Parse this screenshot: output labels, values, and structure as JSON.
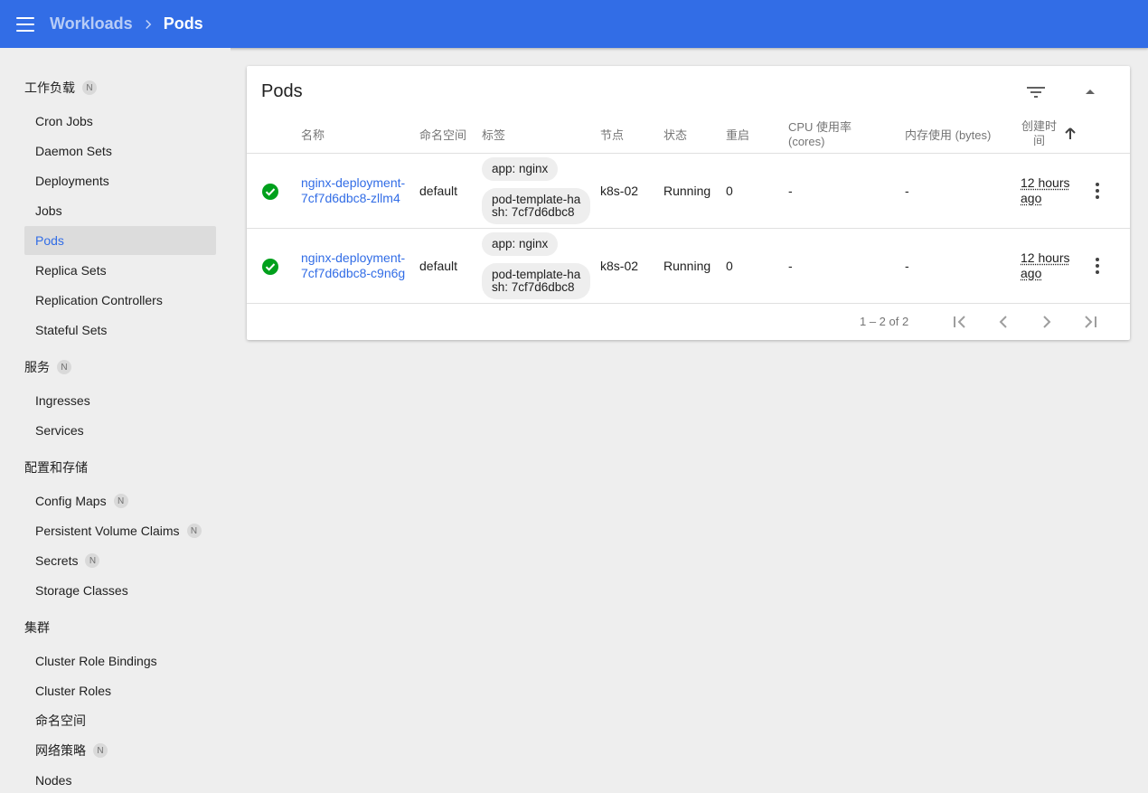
{
  "topbar": {
    "menu_icon": "menu-icon",
    "breadcrumb_parent": "Workloads",
    "breadcrumb_current": "Pods"
  },
  "sidebar": {
    "workloads_header": "工作负载",
    "workloads_items": [
      "Cron Jobs",
      "Daemon Sets",
      "Deployments",
      "Jobs",
      "Pods",
      "Replica Sets",
      "Replication Controllers",
      "Stateful Sets"
    ],
    "services_header": "服务",
    "services_items": [
      "Ingresses",
      "Services"
    ],
    "config_header": "配置和存储",
    "config_items": [
      "Config Maps",
      "Persistent Volume Claims",
      "Secrets",
      "Storage Classes"
    ],
    "cluster_header": "集群",
    "cluster_items": [
      "Cluster Role Bindings",
      "Cluster Roles",
      "命名空间",
      "网络策略",
      "Nodes"
    ],
    "namespace_badge": "N"
  },
  "card": {
    "title": "Pods",
    "columns": {
      "name": "名称",
      "namespace": "命名空间",
      "labels": "标签",
      "node": "节点",
      "status": "状态",
      "restarts": "重启",
      "cpu_line1": "CPU 使用率",
      "cpu_line2": "(cores)",
      "memory": "内存使用 (bytes)",
      "created_line1": "创建时",
      "created_line2": "间"
    },
    "rows": [
      {
        "name_line1": "nginx-deployment-",
        "name_line2": "7cf7d6dbc8-zllm4",
        "namespace": "default",
        "label1": "app: nginx",
        "label2_line1": "pod-template-ha",
        "label2_line2": "sh: 7cf7d6dbc8",
        "node": "k8s-02",
        "status": "Running",
        "restarts": "0",
        "cpu": "-",
        "memory": "-",
        "age_line1": "12 hours",
        "age_line2": "ago"
      },
      {
        "name_line1": "nginx-deployment-",
        "name_line2": "7cf7d6dbc8-c9n6g",
        "namespace": "default",
        "label1": "app: nginx",
        "label2_line1": "pod-template-ha",
        "label2_line2": "sh: 7cf7d6dbc8",
        "node": "k8s-02",
        "status": "Running",
        "restarts": "0",
        "cpu": "-",
        "memory": "-",
        "age_line1": "12 hours",
        "age_line2": "ago"
      }
    ],
    "pager_text": "1 – 2 of 2"
  },
  "colors": {
    "primary": "#326de6",
    "success": "#00a01c",
    "background": "#eeeeee"
  }
}
